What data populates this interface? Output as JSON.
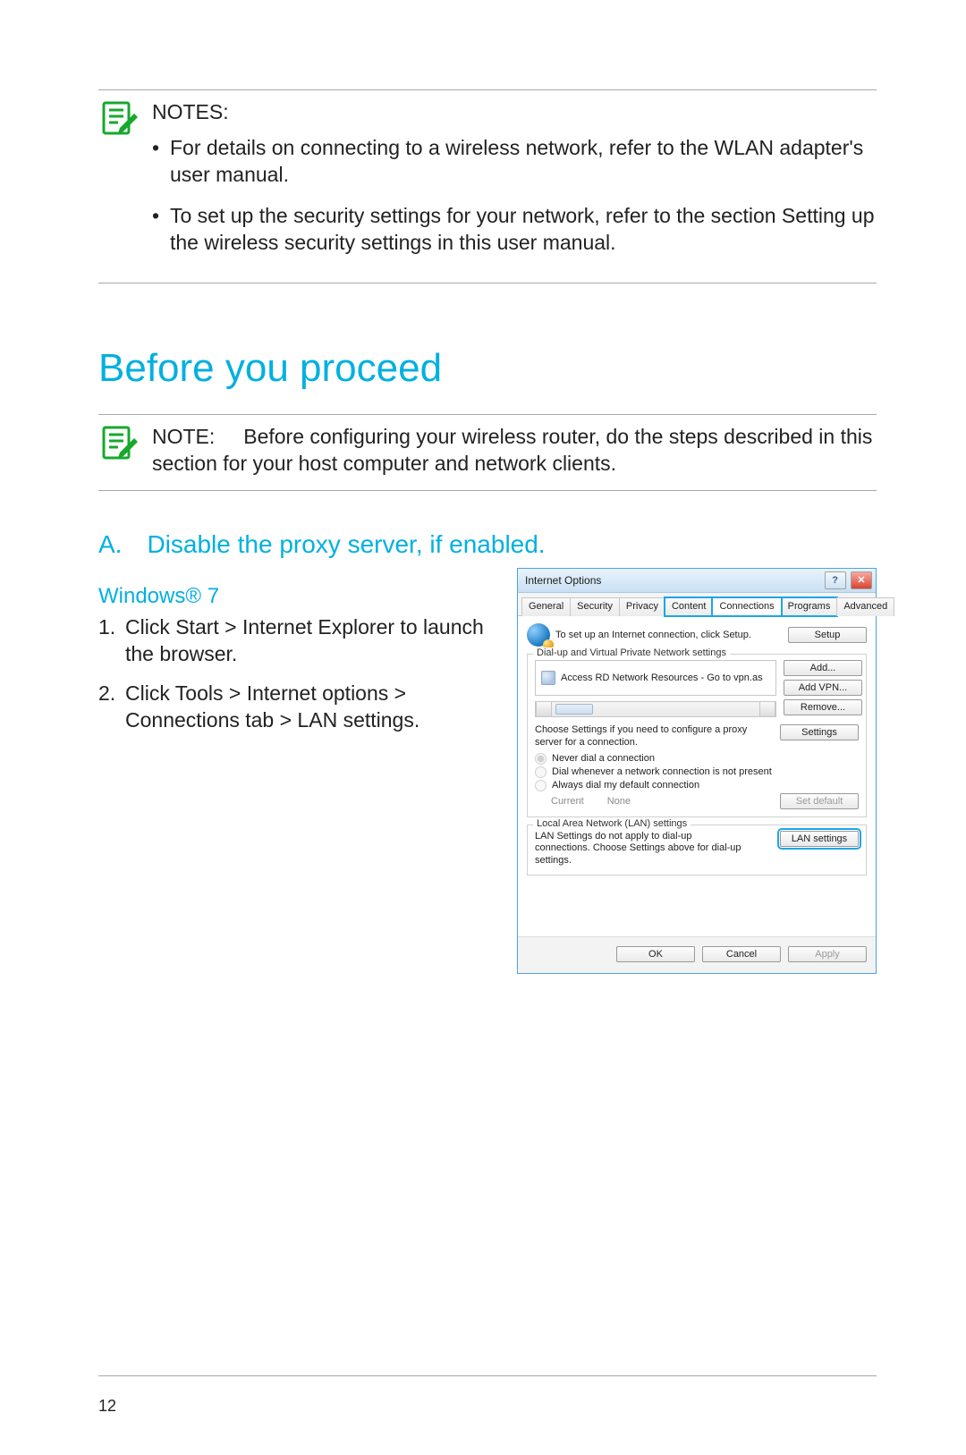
{
  "notes_block": {
    "label": "NOTES:",
    "bullets": [
      "For details on connecting to a wireless network, refer to the WLAN adapter's user manual.",
      "To set up the security settings for your network, refer to the section Setting up the wireless security settings in this user manual."
    ]
  },
  "section_heading": "Before you proceed",
  "note_single": {
    "label": "NOTE:",
    "text": "Before configuring your wireless router, do the steps described in this section for your host computer and network clients."
  },
  "sub_a": "A. Disable the proxy server, if enabled.",
  "os_heading": "Windows® 7",
  "steps": [
    "Click Start > Internet Explorer to launch the browser.",
    "Click Tools > Internet options > Connections tab > LAN settings."
  ],
  "dialog": {
    "title": "Internet Options",
    "tabs": [
      "General",
      "Security",
      "Privacy",
      "Content",
      "Connections",
      "Programs",
      "Advanced"
    ],
    "active_tab_index": 4,
    "setup_text": "To set up an Internet connection, click Setup.",
    "setup_btn": "Setup",
    "dialup_legend": "Dial-up and Virtual Private Network settings",
    "conn_item": "Access RD Network Resources - Go to vpn.as",
    "btn_add": "Add...",
    "btn_addvpn": "Add VPN...",
    "btn_remove": "Remove...",
    "proxy_desc": "Choose Settings if you need to configure a proxy server for a connection.",
    "btn_settings": "Settings",
    "radio1": "Never dial a connection",
    "radio2": "Dial whenever a network connection is not present",
    "radio3": "Always dial my default connection",
    "current_label": "Current",
    "current_value": "None",
    "btn_setdefault": "Set default",
    "lan_legend": "Local Area Network (LAN) settings",
    "lan_desc": "LAN Settings do not apply to dial-up connections. Choose Settings above for dial-up settings.",
    "btn_lan": "LAN settings",
    "btn_ok": "OK",
    "btn_cancel": "Cancel",
    "btn_apply": "Apply"
  },
  "page_number": "12"
}
